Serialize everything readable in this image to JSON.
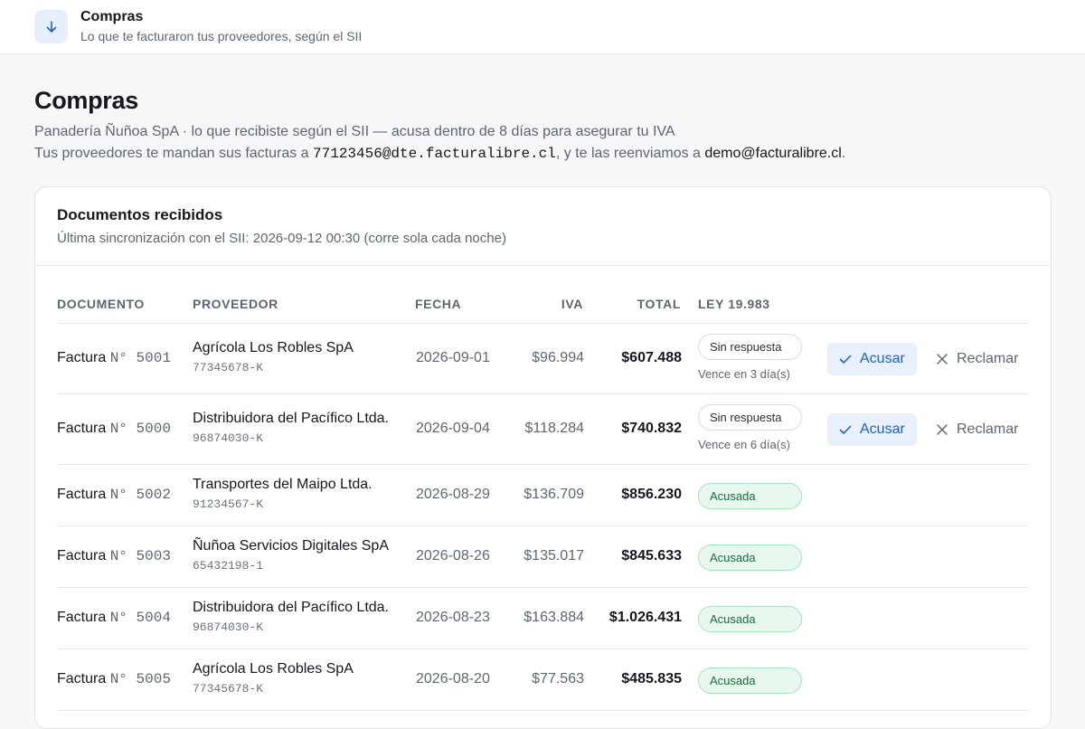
{
  "header": {
    "title": "Compras",
    "subtitle": "Lo que te facturaron tus proveedores, según el SII",
    "icon": "arrow-down-icon"
  },
  "page": {
    "title": "Compras",
    "line1": "Panadería Ñuñoa SpA · lo que recibiste según el SII — acusa dentro de 8 días para asegurar tu IVA",
    "line2_prefix": "Tus proveedores te mandan sus facturas a ",
    "dte_email": "77123456@dte.facturalibre.cl",
    "line2_middle": ", y te las reenviamos a ",
    "forward_email": "demo@facturalibre.cl",
    "line2_suffix": "."
  },
  "card": {
    "title": "Documentos recibidos",
    "subtitle": "Última sincronización con el SII: 2026-09-12 00:30 (corre sola cada noche)"
  },
  "table": {
    "columns": {
      "documento": "DOCUMENTO",
      "proveedor": "PROVEEDOR",
      "fecha": "FECHA",
      "iva": "IVA",
      "total": "TOTAL",
      "ley": "LEY 19.983"
    },
    "actions": {
      "acusar": "Acusar",
      "reclamar": "Reclamar"
    },
    "rows": [
      {
        "doc_type": "Factura",
        "doc_num": "N° 5001",
        "provider": "Agrícola Los Robles SpA",
        "rut": "77345678-K",
        "date": "2026-09-01",
        "iva": "$96.994",
        "total": "$607.488",
        "status": "Sin respuesta",
        "status_kind": "pending",
        "due": "Vence en 3 día(s)"
      },
      {
        "doc_type": "Factura",
        "doc_num": "N° 5000",
        "provider": "Distribuidora del Pacífico Ltda.",
        "rut": "96874030-K",
        "date": "2026-09-04",
        "iva": "$118.284",
        "total": "$740.832",
        "status": "Sin respuesta",
        "status_kind": "pending",
        "due": "Vence en 6 día(s)"
      },
      {
        "doc_type": "Factura",
        "doc_num": "N° 5002",
        "provider": "Transportes del Maipo Ltda.",
        "rut": "91234567-K",
        "date": "2026-08-29",
        "iva": "$136.709",
        "total": "$856.230",
        "status": "Acusada",
        "status_kind": "ok"
      },
      {
        "doc_type": "Factura",
        "doc_num": "N° 5003",
        "provider": "Ñuñoa Servicios Digitales SpA",
        "rut": "65432198-1",
        "date": "2026-08-26",
        "iva": "$135.017",
        "total": "$845.633",
        "status": "Acusada",
        "status_kind": "ok"
      },
      {
        "doc_type": "Factura",
        "doc_num": "N° 5004",
        "provider": "Distribuidora del Pacífico Ltda.",
        "rut": "96874030-K",
        "date": "2026-08-23",
        "iva": "$163.884",
        "total": "$1.026.431",
        "status": "Acusada",
        "status_kind": "ok"
      },
      {
        "doc_type": "Factura",
        "doc_num": "N° 5005",
        "provider": "Agrícola Los Robles SpA",
        "rut": "77345678-K",
        "date": "2026-08-20",
        "iva": "$77.563",
        "total": "$485.835",
        "status": "Acusada",
        "status_kind": "ok"
      }
    ]
  },
  "colors": {
    "accent": "#1f5fbf",
    "accent_bg": "#e8f0fb",
    "ok_text": "#1b6a3e",
    "ok_bg": "#e8f8ef"
  }
}
